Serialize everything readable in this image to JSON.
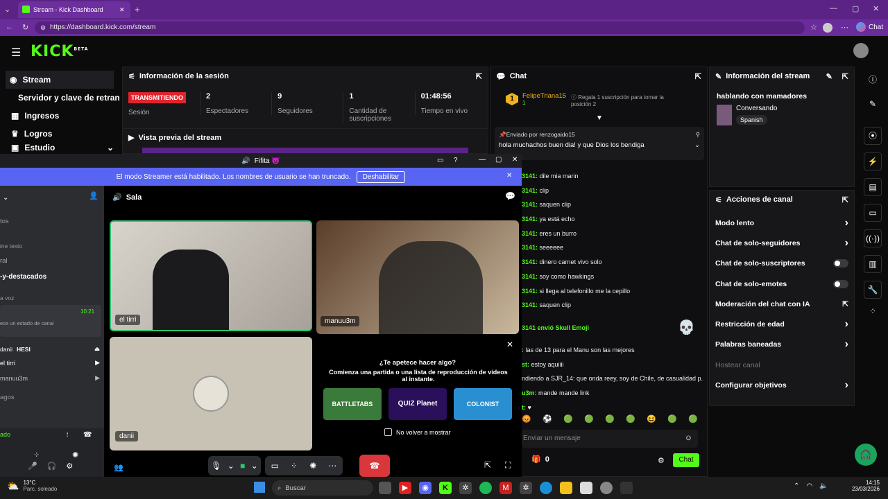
{
  "browser": {
    "tab_title": "Stream - Kick Dashboard",
    "url": "https://dashboard.kick.com/stream",
    "chat_label": "Chat"
  },
  "sidebar": {
    "items": [
      "Stream",
      "Servidor y clave de retransmisión",
      "Ingresos",
      "Logros",
      "Estudio"
    ]
  },
  "session": {
    "title": "Información de la sesión",
    "badge": "TRANSMITIENDO",
    "badge_label": "Sesión",
    "stats": [
      {
        "value": "2",
        "label": "Espectadores"
      },
      {
        "value": "9",
        "label": "Seguidores"
      },
      {
        "value": "1",
        "label": "Cantidad de suscripciones"
      },
      {
        "value": "01:48:56",
        "label": "Tiempo en vivo"
      }
    ],
    "preview_title": "Vista previa del stream"
  },
  "chat": {
    "title": "Chat",
    "top_gifter": "FelipeTriana15",
    "gifter_count": "1",
    "gift_prompt": "Regala 1 suscripción para tomar la posición 2",
    "pinned_by": "Enviado por renzogaido15",
    "pinned_text": "hola muchachos buen dia! y que Dios los bendiga",
    "lines": [
      {
        "u": "3141:",
        "t": "dile mia marin"
      },
      {
        "u": "3141:",
        "t": "clip"
      },
      {
        "u": "3141:",
        "t": "saquen clip"
      },
      {
        "u": "3141:",
        "t": "ya está echo"
      },
      {
        "u": "3141:",
        "t": "eres un burro"
      },
      {
        "u": "3141:",
        "t": "seeeeee"
      },
      {
        "u": "3141:",
        "t": "dinero carnet vivo solo"
      },
      {
        "u": "3141:",
        "t": "soy como hawkings"
      },
      {
        "u": "3141:",
        "t": "si llega al telefonillo me la cepillo"
      },
      {
        "u": "3141:",
        "t": "saquen clip"
      }
    ],
    "emoji_line": "3141 envió Skull Emoji",
    "lines2": [
      {
        "u": ":",
        "t": "las de 13 para el Manu son las mejores"
      },
      {
        "u": "st:",
        "t": "estoy aquiiii"
      },
      {
        "u": "",
        "t": "ndiendo a SJR_14: que onda reey, soy de Chile, de casualidad p..."
      },
      {
        "u": "u3m:",
        "t": "mande mande link"
      },
      {
        "u": "t:",
        "t": "♥"
      }
    ],
    "input_placeholder": "Enviar un mensaje",
    "points": "0",
    "send": "Chat"
  },
  "streaminfo": {
    "title": "Información del stream",
    "stream_title": "hablando con mamadores",
    "category": "Conversando",
    "language": "Spanish"
  },
  "actions": {
    "title": "Acciones de canal",
    "items": [
      {
        "label": "Modo lento",
        "ctl": "arrow"
      },
      {
        "label": "Chat de solo-seguidores",
        "ctl": "arrow"
      },
      {
        "label": "Chat de solo-suscriptores",
        "ctl": "toggle"
      },
      {
        "label": "Chat de solo-emotes",
        "ctl": "toggle"
      },
      {
        "label": "Moderación del chat con IA",
        "ctl": "ext"
      },
      {
        "label": "Restricción de edad",
        "ctl": "arrow"
      },
      {
        "label": "Palabras baneadas",
        "ctl": "arrow"
      },
      {
        "label": "Hostear canal",
        "ctl": "none"
      },
      {
        "label": "Configurar objetivos",
        "ctl": "arrow"
      }
    ]
  },
  "discord": {
    "window_title": "Fifita 😈",
    "banner_text": "El modo Streamer está habilitado. Los nombres de usuario se han truncado.",
    "banner_button": "Deshabilitar",
    "channel": "Sala",
    "left_items": [
      "tos",
      "ine texto",
      "ral",
      "-y-destacados",
      "a voz",
      "ece un estado de canal",
      "danii",
      "el tirri",
      "manuu3m",
      "agos",
      "ado"
    ],
    "hesi": "HESI",
    "time": "10:21",
    "participants": [
      "el tirri",
      "manuu3m",
      "danii"
    ],
    "activity_title": "¿Te apetece hacer algo?",
    "activity_sub": "Comienza una partida o una lista de reproducción de vídeos al instante.",
    "games": [
      "BATTLETABS",
      "QUIZ Planet",
      "COLONIST"
    ],
    "dont_show": "No volver a mostrar"
  },
  "taskbar": {
    "weather_temp": "13°C",
    "weather_text": "Parc. soleado",
    "search": "Buscar",
    "time": "14:15",
    "date": "23/03/2026"
  },
  "colors": {
    "kick_green": "#53fc18",
    "discord_blurple": "#5865f2",
    "browser_purple": "#5b2386",
    "hangup_red": "#da373c"
  }
}
